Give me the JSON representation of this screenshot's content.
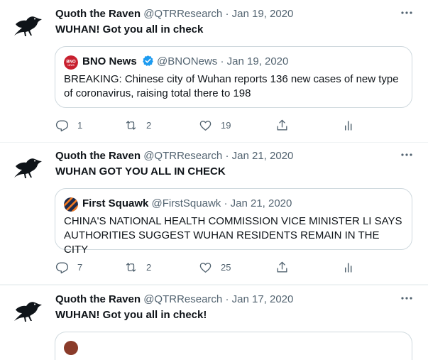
{
  "tweets": [
    {
      "author_name": "Quoth the Raven",
      "author_handle": "@QTRResearch",
      "separator": "·",
      "date": "Jan 19, 2020",
      "text": "WUHAN! Got you all in check",
      "quote": {
        "author_name": "BNO News",
        "author_handle": "@BNONews",
        "separator": "·",
        "date": "Jan 19, 2020",
        "verified": true,
        "avatar_text": "BNO",
        "text": "BREAKING: Chinese city of Wuhan reports 136 new cases of new type of coronavirus, raising total there to 198"
      },
      "replies": "1",
      "retweets": "2",
      "likes": "19"
    },
    {
      "author_name": "Quoth the Raven",
      "author_handle": "@QTRResearch",
      "separator": "·",
      "date": "Jan 21, 2020",
      "text": "WUHAN GOT YOU ALL IN CHECK",
      "quote": {
        "author_name": "First Squawk",
        "author_handle": "@FirstSquawk",
        "separator": "·",
        "date": "Jan 21, 2020",
        "verified": false,
        "text": "CHINA'S NATIONAL HEALTH COMMISSION VICE MINISTER LI SAYS AUTHORITIES SUGGEST WUHAN RESIDENTS REMAIN IN THE CITY"
      },
      "replies": "7",
      "retweets": "2",
      "likes": "25"
    },
    {
      "author_name": "Quoth the Raven",
      "author_handle": "@QTRResearch",
      "separator": "·",
      "date": "Jan 17, 2020",
      "text": "WUHAN! Got you all in check!"
    }
  ],
  "icons": {
    "more": "more-horizontal-icon",
    "reply": "reply-icon",
    "retweet": "retweet-icon",
    "like": "heart-icon",
    "share": "share-icon",
    "analytics": "analytics-icon"
  },
  "colors": {
    "text": "#0f1419",
    "secondary": "#536471",
    "border": "#cfd9de",
    "verified": "#1d9bf0",
    "bno_red": "#c8202f"
  }
}
